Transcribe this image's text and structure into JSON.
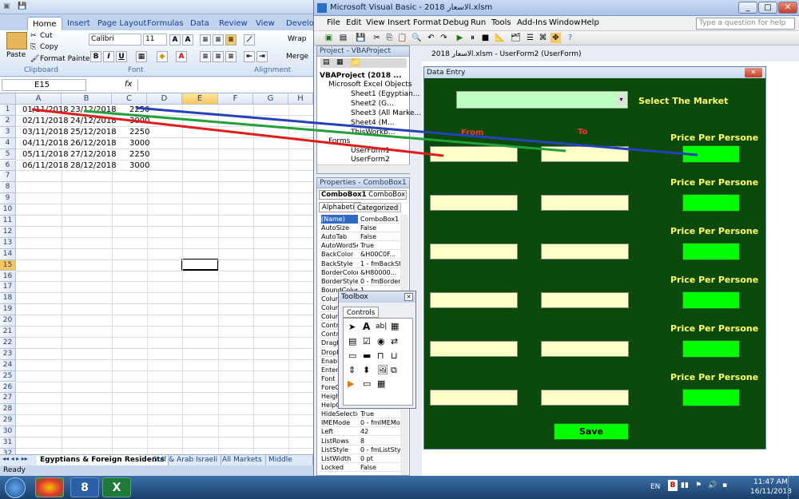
{
  "excel": {
    "tabs": [
      "Home",
      "Insert",
      "Page Layout",
      "Formulas",
      "Data",
      "Review",
      "View",
      "Develope"
    ],
    "clipboard": {
      "paste": "Paste",
      "cut": "Cut",
      "copy": "Copy",
      "painter": "Format Painter",
      "group": "Clipboard"
    },
    "font": {
      "name": "Calibri",
      "size": "11",
      "group": "Font",
      "bold": "B",
      "italic": "I",
      "underline": "U"
    },
    "alignment": {
      "group": "Alignment",
      "wrap": "Wrap",
      "merge": "Merge"
    },
    "namebox": "E15",
    "fx": "fx",
    "columns": [
      "A",
      "B",
      "C",
      "D",
      "E",
      "F",
      "G",
      "H"
    ],
    "rows": [
      "1",
      "2",
      "3",
      "4",
      "5",
      "6",
      "7",
      "8",
      "9",
      "10",
      "11",
      "12",
      "13",
      "14",
      "15",
      "16",
      "17",
      "18",
      "19",
      "20",
      "21",
      "22",
      "23",
      "24",
      "25",
      "26",
      "27",
      "28",
      "29",
      "30",
      "31",
      "32"
    ],
    "data": [
      {
        "a": "01/11/2018",
        "b": "23/12/2018",
        "c": "2250"
      },
      {
        "a": "02/11/2018",
        "b": "24/12/2018",
        "c": "3000"
      },
      {
        "a": "03/11/2018",
        "b": "25/12/2018",
        "c": "2250"
      },
      {
        "a": "04/11/2018",
        "b": "26/12/2018",
        "c": "3000"
      },
      {
        "a": "05/11/2018",
        "b": "27/12/2018",
        "c": "2250"
      },
      {
        "a": "06/11/2018",
        "b": "28/12/2018",
        "c": "3000"
      }
    ],
    "sheets": [
      "Egyptians & Foreign Residents",
      "Gulf & Arab Israeli",
      "All Markets",
      "Middle East"
    ],
    "status": "Ready"
  },
  "vbe": {
    "title": "Microsoft Visual Basic - 2018 الاسعار.xlsm",
    "menu": [
      "File",
      "Edit",
      "View",
      "Insert",
      "Format",
      "Debug",
      "Run",
      "Tools",
      "Add-Ins",
      "Window",
      "Help"
    ],
    "ask": "Type a question for help",
    "project": {
      "title": "Project - VBAProject",
      "root": "VBAProject (2018 ...",
      "excel_objects": "Microsoft Excel Objects",
      "items": [
        "Sheet1 (Egyptian...",
        "Sheet2 (G...",
        "Sheet3 (All Marke...",
        "Sheet4 (M...",
        "ThisWorkb..."
      ],
      "forms": "Forms",
      "forms_items": [
        "UserForm1",
        "UserForm2"
      ]
    },
    "properties": {
      "title": "Properties - ComboBox1",
      "object": "ComboBox1",
      "type": "ComboBox",
      "tab_alpha": "Alphabetic",
      "tab_cat": "Categorized",
      "rows": [
        [
          "(Name)",
          "ComboBox1"
        ],
        [
          "AutoSize",
          "False"
        ],
        [
          "AutoTab",
          "False"
        ],
        [
          "AutoWordSele",
          "True"
        ],
        [
          "BackColor",
          "&H00C0F..."
        ],
        [
          "BackStyle",
          "1 - fmBackSt"
        ],
        [
          "BorderColor",
          "&H80000..."
        ],
        [
          "BorderStyle",
          "0 - fmBorder"
        ],
        [
          "BoundColumn",
          "1"
        ],
        [
          "Colum",
          ""
        ],
        [
          "Colum",
          ""
        ],
        [
          "Colum",
          ""
        ],
        [
          "Contro",
          ""
        ],
        [
          "Contro",
          ""
        ],
        [
          "DragB",
          ""
        ],
        [
          "DropB",
          ""
        ],
        [
          "Enable",
          ""
        ],
        [
          "EnterF",
          ""
        ],
        [
          "Font",
          ""
        ],
        [
          "ForeC",
          ""
        ],
        [
          "Height",
          ""
        ],
        [
          "HelpC",
          ""
        ],
        [
          "HideSelection",
          "True"
        ],
        [
          "IMEMode",
          "0 - fmIMEMo"
        ],
        [
          "Left",
          "42"
        ],
        [
          "ListRows",
          "8"
        ],
        [
          "ListStyle",
          "0 - fmListStyl"
        ],
        [
          "ListWidth",
          "0 pt"
        ],
        [
          "Locked",
          "False"
        ]
      ]
    },
    "doc_title": "2018 الاسعار.xlsm - UserForm2 (UserForm)",
    "toolbox": {
      "title": "Toolbox",
      "tab": "Controls"
    }
  },
  "form": {
    "title": "Data Entry",
    "market_label": "Select The Market",
    "from": "From",
    "to": "To",
    "price_label": "Price Per Persone",
    "save": "Save"
  },
  "taskbar": {
    "lang": "EN",
    "time": "11:47 AM",
    "date": "16/11/2018",
    "ie_label": "8"
  }
}
